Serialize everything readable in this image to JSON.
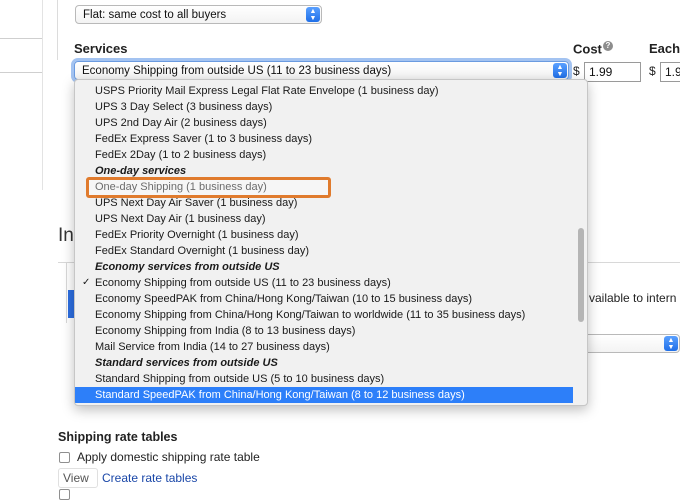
{
  "domestic": {
    "cost_type_select": "Flat: same cost to all buyers",
    "services_label": "Services",
    "cost_label": "Cost",
    "cost_help": "?",
    "each_label": "Each",
    "service_select_value": "Economy Shipping from outside US (11 to 23 business days)",
    "currency": "$",
    "cost_value": "1.99",
    "each_value": "1.9"
  },
  "menu": {
    "items": [
      {
        "label": "USPS Priority Mail Express Legal Flat Rate Envelope (1 business day)",
        "kind": "item"
      },
      {
        "label": "UPS 3 Day Select (3 business days)",
        "kind": "item"
      },
      {
        "label": "UPS 2nd Day Air (2 business days)",
        "kind": "item"
      },
      {
        "label": "FedEx Express Saver (1 to 3 business days)",
        "kind": "item"
      },
      {
        "label": "FedEx 2Day (1 to 2 business days)",
        "kind": "item"
      },
      {
        "label": "One-day services",
        "kind": "group"
      },
      {
        "label": "One-day Shipping (1 business day)",
        "kind": "item"
      },
      {
        "label": "UPS Next Day Air Saver (1 business day)",
        "kind": "item"
      },
      {
        "label": "UPS Next Day Air (1 business day)",
        "kind": "item"
      },
      {
        "label": "FedEx Priority Overnight (1 business day)",
        "kind": "item"
      },
      {
        "label": "FedEx Standard Overnight (1 business day)",
        "kind": "item"
      },
      {
        "label": "Economy services from outside US",
        "kind": "group"
      },
      {
        "label": "Economy Shipping from outside US (11 to 23 business days)",
        "kind": "item",
        "checkmark": "✓"
      },
      {
        "label": "Economy SpeedPAK from China/Hong Kong/Taiwan (10 to 15 business days)",
        "kind": "item"
      },
      {
        "label": "Economy Shipping from China/Hong Kong/Taiwan to worldwide (11 to 35 business days)",
        "kind": "item"
      },
      {
        "label": "Economy Shipping from India (8 to 13 business days)",
        "kind": "item"
      },
      {
        "label": "Mail Service from India (14 to 27 business days)",
        "kind": "item"
      },
      {
        "label": "Standard services from outside US",
        "kind": "group"
      },
      {
        "label": "Standard Shipping from outside US (5 to 10 business days)",
        "kind": "item"
      },
      {
        "label": "Standard SpeedPAK from China/Hong Kong/Taiwan (8 to 12 business days)",
        "kind": "item",
        "highlighted": true
      }
    ]
  },
  "background": {
    "intl_heading_partial": "Int",
    "available_partial": "vailable to intern",
    "rate_tables_heading": "Shipping rate tables",
    "apply_domestic": "Apply domestic shipping rate table",
    "view_label": "View",
    "create_link": "Create rate tables"
  }
}
